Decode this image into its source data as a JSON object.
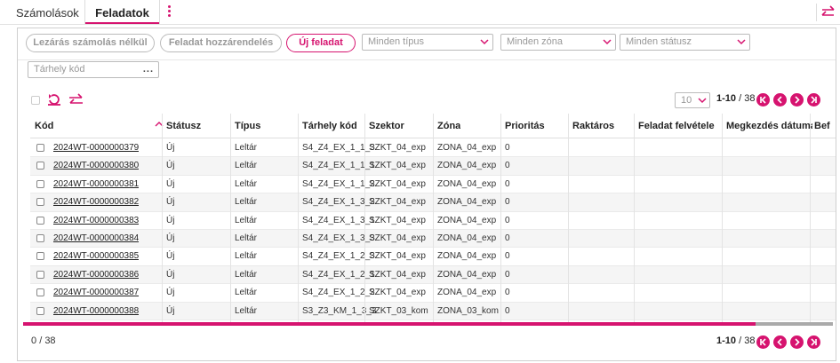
{
  "tabs": [
    {
      "label": "Számolások",
      "active": false
    },
    {
      "label": "Feladatok",
      "active": true
    }
  ],
  "actions": {
    "btn_close": "Lezárás számolás nélkül",
    "btn_assign": "Feladat hozzárendelés",
    "btn_new": "Új feladat"
  },
  "filters": {
    "type_placeholder": "Minden típus",
    "zone_placeholder": "Minden zóna",
    "status_placeholder": "Minden státusz",
    "location_placeholder": "Tárhely kód",
    "location_button": "..."
  },
  "pagination": {
    "page_size": "10",
    "range": "1-10",
    "total": "/ 38"
  },
  "selection": {
    "count": "0",
    "separator": "/",
    "total": "38"
  },
  "columns": [
    "Kód",
    "Státusz",
    "Típus",
    "Tárhely kód",
    "Szektor",
    "Zóna",
    "Prioritás",
    "Raktáros",
    "Feladat felvétele",
    "Megkezdés dátuma",
    "Bef"
  ],
  "rows": [
    {
      "code": "2024WT-0000000379",
      "status": "Új",
      "type": "Leltár",
      "location": "S4_Z4_EX_1_1_3",
      "sector": "SZKT_04_exp",
      "zone": "ZONA_04_exp",
      "priority": "0"
    },
    {
      "code": "2024WT-0000000380",
      "status": "Új",
      "type": "Leltár",
      "location": "S4_Z4_EX_1_1_1",
      "sector": "SZKT_04_exp",
      "zone": "ZONA_04_exp",
      "priority": "0"
    },
    {
      "code": "2024WT-0000000381",
      "status": "Új",
      "type": "Leltár",
      "location": "S4_Z4_EX_1_1_2",
      "sector": "SZKT_04_exp",
      "zone": "ZONA_04_exp",
      "priority": "0"
    },
    {
      "code": "2024WT-0000000382",
      "status": "Új",
      "type": "Leltár",
      "location": "S4_Z4_EX_1_3_2",
      "sector": "SZKT_04_exp",
      "zone": "ZONA_04_exp",
      "priority": "0"
    },
    {
      "code": "2024WT-0000000383",
      "status": "Új",
      "type": "Leltár",
      "location": "S4_Z4_EX_1_3_1",
      "sector": "SZKT_04_exp",
      "zone": "ZONA_04_exp",
      "priority": "0"
    },
    {
      "code": "2024WT-0000000384",
      "status": "Új",
      "type": "Leltár",
      "location": "S4_Z4_EX_1_3_3",
      "sector": "SZKT_04_exp",
      "zone": "ZONA_04_exp",
      "priority": "0"
    },
    {
      "code": "2024WT-0000000385",
      "status": "Új",
      "type": "Leltár",
      "location": "S4_Z4_EX_1_2_3",
      "sector": "SZKT_04_exp",
      "zone": "ZONA_04_exp",
      "priority": "0"
    },
    {
      "code": "2024WT-0000000386",
      "status": "Új",
      "type": "Leltár",
      "location": "S4_Z4_EX_1_2_1",
      "sector": "SZKT_04_exp",
      "zone": "ZONA_04_exp",
      "priority": "0"
    },
    {
      "code": "2024WT-0000000387",
      "status": "Új",
      "type": "Leltár",
      "location": "S4_Z4_EX_1_2_2",
      "sector": "SZKT_04_exp",
      "zone": "ZONA_04_exp",
      "priority": "0"
    },
    {
      "code": "2024WT-0000000388",
      "status": "Új",
      "type": "Leltár",
      "location": "S3_Z3_KM_1_3_3",
      "sector": "SZKT_03_kom",
      "zone": "ZONA_03_kom",
      "priority": "0"
    }
  ],
  "colors": {
    "accent": "#d6136f",
    "row_alt": "#f5f5f5",
    "border": "#cfcfcf"
  },
  "icons": [
    "kebab-menu-icon",
    "swap-arrows-icon",
    "refresh-icon",
    "sort-ascending-icon",
    "first-page-icon",
    "prev-page-icon",
    "next-page-icon",
    "last-page-icon",
    "chevron-down-icon"
  ]
}
